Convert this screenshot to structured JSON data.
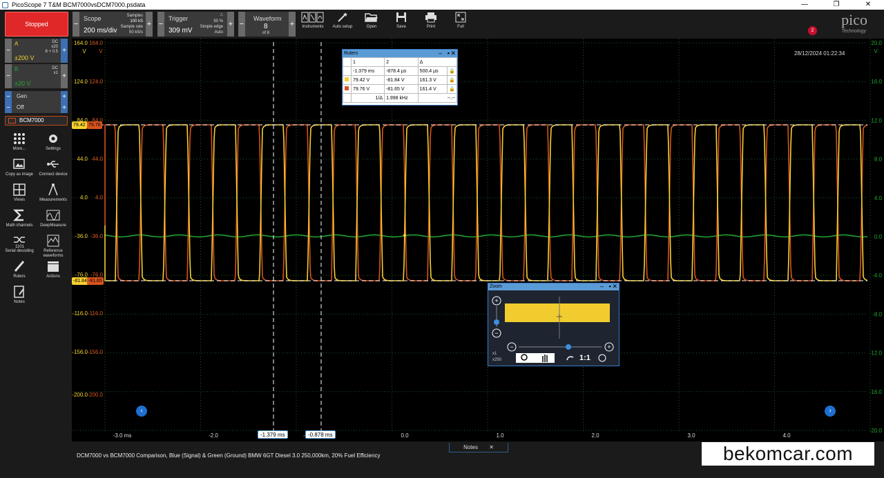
{
  "window": {
    "title": "PicoScope 7 T&M BCM7000vsDCM7000.psdata"
  },
  "toolbar": {
    "stop_label": "Stopped",
    "scope": {
      "label": "Scope",
      "value": "200 ms/div",
      "samples_label": "Samples",
      "samples": "100 kS",
      "rate_label": "Sample rate",
      "rate": "50 kS/s"
    },
    "trigger": {
      "label": "Trigger",
      "value": "309 mV",
      "pct": "50 %",
      "mode": "Simple edge",
      "auto": "Auto"
    },
    "waveform": {
      "label": "Waveform",
      "value": "8",
      "of": "of 8"
    },
    "buttons": [
      "Instruments",
      "Auto setup",
      "Open",
      "Save",
      "Print",
      "Full"
    ]
  },
  "logo": {
    "word": "pico",
    "tech": "Technology",
    "badge": "2"
  },
  "channels": {
    "a": {
      "name": "A",
      "coupling": "DC",
      "probe": "x20",
      "offset": "8 + 0.5",
      "range": "±200 V",
      "color": "#f5d130"
    },
    "b": {
      "name": "B",
      "coupling": "DC",
      "probe": "x1",
      "range": "±20 V",
      "color": "#22a832"
    },
    "gen": {
      "label": "Gen",
      "state": "Off"
    },
    "device": "BCM7000"
  },
  "tools": [
    {
      "label": "More...",
      "icon": "more-icon"
    },
    {
      "label": "Settings",
      "icon": "gear-icon"
    },
    {
      "label": "Copy as image",
      "icon": "image-icon"
    },
    {
      "label": "Connect device",
      "icon": "usb-icon"
    },
    {
      "label": "Views",
      "icon": "grid-icon"
    },
    {
      "label": "Measurements",
      "icon": "compass-icon"
    },
    {
      "label": "Math channels",
      "icon": "sigma-icon"
    },
    {
      "label": "DeepMeasure",
      "icon": "deepmeasure-icon"
    },
    {
      "label": "Serial decoding",
      "icon": "serial-icon"
    },
    {
      "label": "Reference waveforms",
      "icon": "reference-icon"
    },
    {
      "label": "Rulers",
      "icon": "ruler-icon"
    },
    {
      "label": "Actions",
      "icon": "clapper-icon"
    },
    {
      "label": "Notes",
      "icon": "notes-icon"
    }
  ],
  "scope_view": {
    "datetime": "28/12/2024 01:22:34",
    "y_labels_a": [
      "164.0",
      "124.0",
      "84.0",
      "44.0",
      "4.0",
      "-36.0",
      "-76.0",
      "-116.0",
      "-156.0",
      "-200.0"
    ],
    "y_labels_b": [
      "20.0",
      "16.0",
      "12.0",
      "8.0",
      "4.0",
      "0.0",
      "-4.0",
      "-8.0",
      "-12.0",
      "-16.0",
      "-20.0"
    ],
    "unit": "V",
    "x_labels": [
      "-3.0 ms",
      "-2.0",
      "-1.0",
      "0.0",
      "1.0",
      "2.0",
      "3.0",
      "4.0"
    ],
    "ruler_tags": {
      "top_a": "79.42",
      "top_b": "79.76",
      "bot_a": "-81.84",
      "bot_b": "-81.65"
    },
    "cursor_tags": [
      "-1.379 ms",
      "-0.878 ms"
    ]
  },
  "rulers": {
    "title": "Rulers",
    "headers": [
      "1",
      "2",
      "Δ"
    ],
    "rows": [
      {
        "c1": "-1.379 ms",
        "c2": "-878.4 µs",
        "d": "500.4 µs",
        "swatch": ""
      },
      {
        "c1": "79.42 V",
        "c2": "-81.84 V",
        "d": "161.3 V",
        "swatch": "#f5d130"
      },
      {
        "c1": "79.76 V",
        "c2": "-81.65 V",
        "d": "161.4 V",
        "swatch": "#d9531e"
      }
    ],
    "freq_label": "1/Δ",
    "freq": "1.998 kHz",
    "freq2": "--.--"
  },
  "zoom": {
    "title": "Zoom",
    "x1": "x1",
    "x250": "x250",
    "ratio": "1:1"
  },
  "notes": {
    "tab": "Notes",
    "text": "DCM7000 vs BCM7000 Comparison, Blue (Signal) & Green (Ground) BMW 6GT Diesel 3.0 250,000km, 20% Fuel Efficiency"
  },
  "watermark": "bekomcar.com"
}
